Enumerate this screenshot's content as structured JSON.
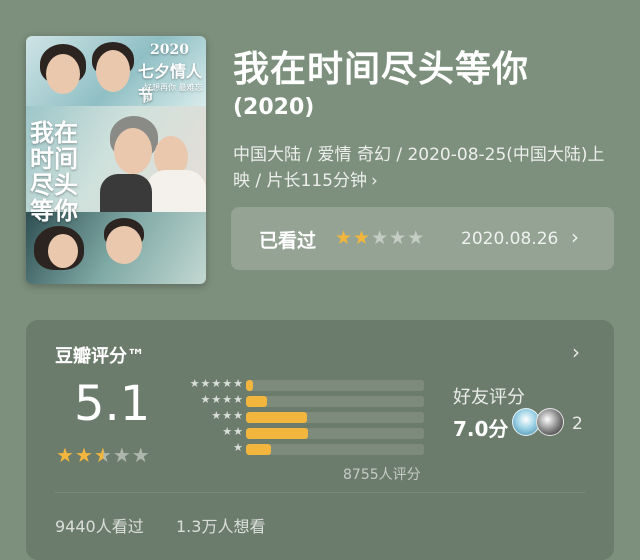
{
  "movie": {
    "title": "我在时间尽头等你",
    "year": "(2020)",
    "meta": "中国大陆 / 爱情 奇幻 / 2020-08-25(中国大陆)上映 / 片长115分钟",
    "meta_chevron": "›",
    "poster": {
      "year_text": "2020",
      "festival_text": "七夕情人节",
      "tagline": "好想再你  最难忘那",
      "title_text": "我在时间尽头等你"
    }
  },
  "watched": {
    "label": "已看过",
    "user_rating": 2,
    "date": "2020.08.26",
    "chevron": "›"
  },
  "rating": {
    "heading": "豆瓣评分™",
    "chevron": "›",
    "score": "5.1",
    "score_stars": 2.5,
    "distribution": [
      {
        "stars": 5,
        "percent": 4
      },
      {
        "stars": 4,
        "percent": 12
      },
      {
        "stars": 3,
        "percent": 34
      },
      {
        "stars": 2,
        "percent": 35
      },
      {
        "stars": 1,
        "percent": 14
      }
    ],
    "count_label": "8755人评分",
    "friends_label": "好友评分",
    "friends_score": "7.0分",
    "friends_count": "2",
    "watched_stat": "9440人看过",
    "wish_stat": "1.3万人想看"
  },
  "colors": {
    "background": "#7d8f7d",
    "card": "#6c7c6c",
    "star": "#f2b53d"
  }
}
